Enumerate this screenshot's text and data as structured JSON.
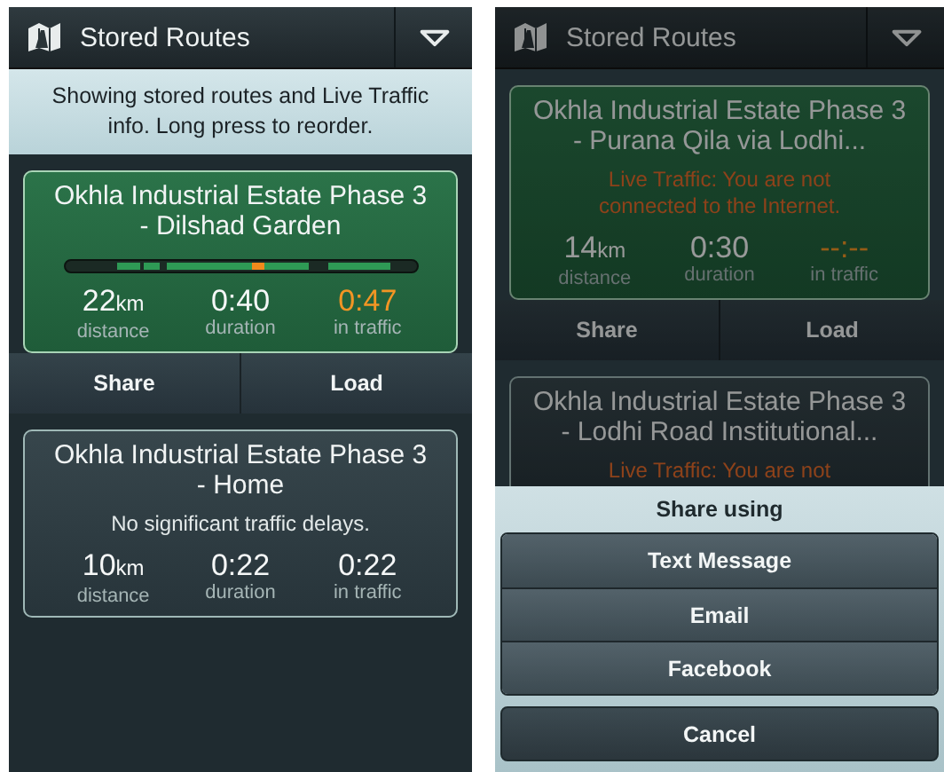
{
  "screens": [
    {
      "dimmed": false,
      "header": {
        "title": "Stored Routes"
      },
      "banner": "Showing stored routes and Live Traffic info. Long press to reorder.",
      "routes": [
        {
          "kind": "delayed",
          "selected": true,
          "title": "Okhla Industrial Estate Phase 3 - Dilshad Garden",
          "stats": [
            {
              "value": "22",
              "unit": "km",
              "label": "distance"
            },
            {
              "value": "0:40",
              "label": "duration"
            },
            {
              "value": "0:47",
              "label": "in traffic"
            }
          ],
          "actions": [
            "Share",
            "Load"
          ]
        },
        {
          "kind": "clear",
          "selected": false,
          "title": "Okhla Industrial Estate Phase 3 - Home",
          "message": "No significant traffic delays.",
          "stats": [
            {
              "value": "10",
              "unit": "km",
              "label": "distance"
            },
            {
              "value": "0:22",
              "label": "duration"
            },
            {
              "value": "0:22",
              "label": "in traffic"
            }
          ]
        }
      ]
    },
    {
      "dimmed": true,
      "header": {
        "title": "Stored Routes"
      },
      "routes": [
        {
          "kind": "offline",
          "selected": true,
          "title": "Okhla Industrial Estate Phase 3 - Purana Qila via Lodhi...",
          "message": "Live Traffic: You are not connected to the Internet.",
          "stats": [
            {
              "value": "14",
              "unit": "km",
              "label": "distance"
            },
            {
              "value": "0:30",
              "label": "duration"
            },
            {
              "value": "--:--",
              "label": "in traffic"
            }
          ],
          "actions": [
            "Share",
            "Load"
          ]
        },
        {
          "kind": "offline",
          "selected": false,
          "title": "Okhla Industrial Estate Phase 3 - Lodhi Road Institutional...",
          "message": "Live Traffic: You are not"
        }
      ],
      "share_sheet": {
        "title": "Share using",
        "options": [
          "Text Message",
          "Email",
          "Facebook"
        ],
        "cancel": "Cancel"
      }
    }
  ]
}
